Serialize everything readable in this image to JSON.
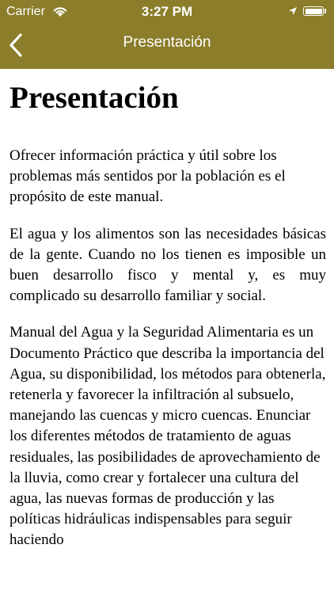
{
  "status_bar": {
    "carrier": "Carrier",
    "time": "3:27 PM",
    "icons": [
      "wifi-icon",
      "location-icon",
      "battery-icon"
    ],
    "battery_level": 1.0
  },
  "nav": {
    "back_icon": "chevron-left-icon",
    "title": "Presentación",
    "background_color": "#8b7d2a",
    "text_color": "#ffffff"
  },
  "content": {
    "title": "Presentación",
    "paragraphs": [
      "Ofrecer información práctica y útil sobre los problemas más sentidos por la población es el propósito de este manual.",
      "El agua y los alimentos son las necesidades básicas de la gente. Cuando no los tienen es imposible un buen desarrollo fisco y mental y, es muy complicado su desarrollo familiar y social.",
      "Manual del Agua y la Seguridad Alimentaria es un Documento Práctico que describa la importancia del Agua, su disponibilidad, los métodos para obtenerla, retenerla y favorecer la infiltración al subsuelo, manejando las cuencas y micro cuencas. Enunciar los diferentes métodos de tratamiento de aguas residuales, las posibilidades de aprovechamiento de la lluvia, como crear y fortalecer una cultura del agua, las nuevas formas de producción y las políticas hidráulicas indispensables para seguir haciendo"
    ]
  }
}
